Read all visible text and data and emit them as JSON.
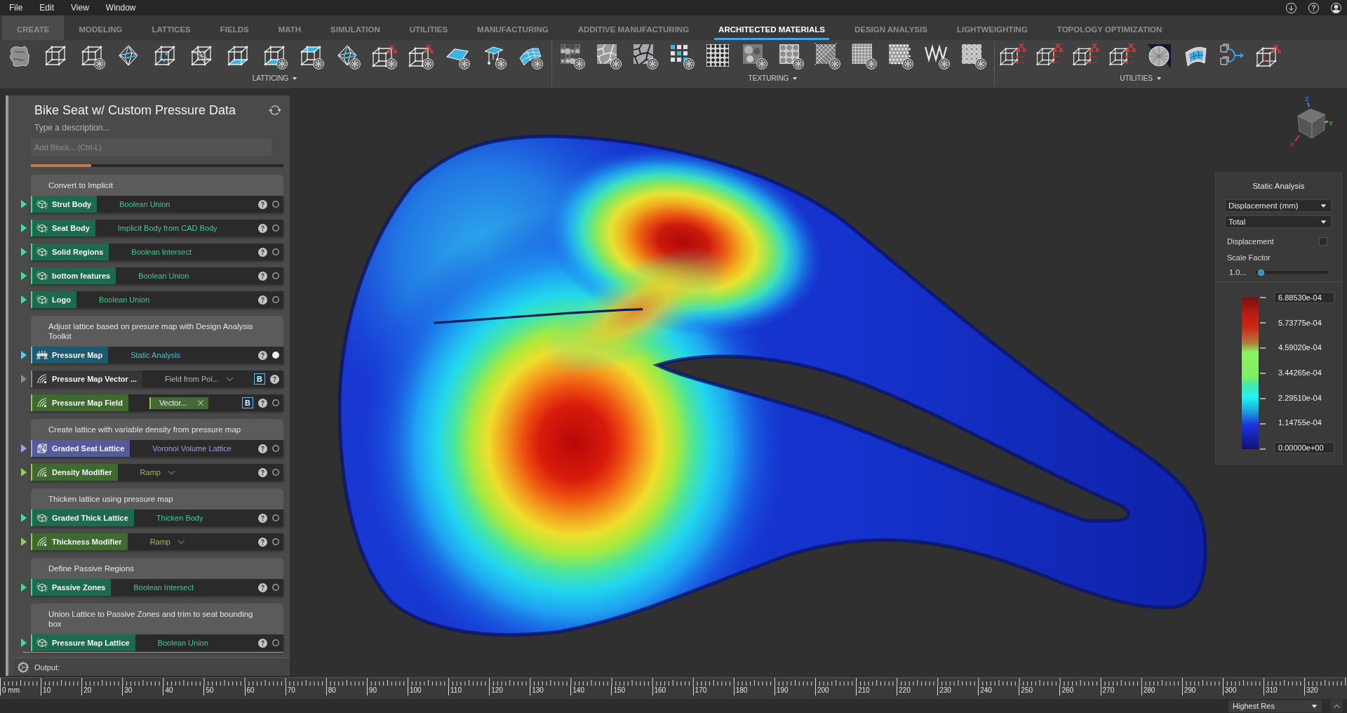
{
  "menu_bar": {
    "items": [
      "File",
      "Edit",
      "View",
      "Window"
    ]
  },
  "tabs": [
    {
      "label": "CREATE",
      "selected": false,
      "hovered": true
    },
    {
      "label": "MODELING",
      "selected": false,
      "hovered": false
    },
    {
      "label": "LATTICES",
      "selected": false,
      "hovered": false
    },
    {
      "label": "FIELDS",
      "selected": false,
      "hovered": false
    },
    {
      "label": "MATH",
      "selected": false,
      "hovered": false
    },
    {
      "label": "SIMULATION",
      "selected": false,
      "hovered": false
    },
    {
      "label": "UTILITIES",
      "selected": false,
      "hovered": false
    },
    {
      "label": "MANUFACTURING",
      "selected": false,
      "hovered": false
    },
    {
      "label": "ADDITIVE MANUFACTURING",
      "selected": false,
      "hovered": false
    },
    {
      "label": "ARCHITECTED MATERIALS",
      "selected": true,
      "hovered": false
    },
    {
      "label": "DESIGN ANALYSIS",
      "selected": false,
      "hovered": false
    },
    {
      "label": "LIGHTWEIGHTING",
      "selected": false,
      "hovered": false
    },
    {
      "label": "TOPOLOGY OPTIMIZATION",
      "selected": false,
      "hovered": false
    }
  ],
  "toolbar": {
    "groups": [
      {
        "label": "LATTICING"
      },
      {
        "label": "TEXTURING"
      },
      {
        "label": "UTILITIES"
      }
    ]
  },
  "workflow_panel": {
    "title": "Bike Seat w/ Custom Pressure Data",
    "description": {
      "placeholder": "Type a description..."
    },
    "add_block": {
      "placeholder": "Add Block... (Ctrl-L)"
    },
    "progress": {
      "level": 0.24
    },
    "sections": [
      {
        "heading": "Convert to Implicit",
        "blocks": [
          {
            "name": "Strut Body",
            "kind": "implicit",
            "operation": {
              "kind": "text",
              "label": "Boolean Union"
            },
            "expandable": true,
            "indicator": {
              "active": false
            }
          },
          {
            "name": "Seat Body",
            "kind": "implicit",
            "operation": {
              "kind": "text",
              "label": "Implicit Body from CAD Body"
            },
            "expandable": true,
            "indicator": {
              "active": false
            }
          },
          {
            "name": "Solid Regions",
            "kind": "implicit",
            "operation": {
              "kind": "text",
              "label": "Boolean Intersect"
            },
            "expandable": true,
            "indicator": {
              "active": false
            }
          },
          {
            "name": "bottom features",
            "kind": "implicit",
            "operation": {
              "kind": "text",
              "label": "Boolean Union"
            },
            "expandable": true,
            "indicator": {
              "active": false
            }
          },
          {
            "name": "Logo",
            "kind": "implicit",
            "operation": {
              "kind": "text",
              "label": "Boolean Union"
            },
            "expandable": true,
            "indicator": {
              "active": false
            }
          }
        ]
      },
      {
        "heading": "Adjust lattice based on presure map with Design Analysis Toolkit",
        "blocks": [
          {
            "name": "Pressure Map",
            "kind": "analysis",
            "operation": {
              "kind": "text",
              "label": "Static Analysis"
            },
            "expandable": true,
            "indicator": {
              "active": true
            }
          },
          {
            "name": "Pressure Map Vector ...",
            "kind": "data",
            "operation": {
              "kind": "dropdown",
              "label": "Field from Poi..."
            },
            "expandable": true,
            "badge": "B"
          },
          {
            "name": "Pressure Map Field",
            "kind": "field",
            "operation": {
              "kind": "chip",
              "label": "Vector..."
            },
            "expandable": false,
            "badge": "B",
            "indicator": {
              "active": false
            }
          }
        ]
      },
      {
        "heading": "Create lattice with variable density from pressure map",
        "blocks": [
          {
            "name": "Graded Seat Lattice",
            "kind": "lattice",
            "operation": {
              "kind": "text",
              "label": "Voronoi Volume Lattice"
            },
            "expandable": true,
            "indicator": {
              "active": false
            }
          },
          {
            "name": "Density Modifier",
            "kind": "field",
            "operation": {
              "kind": "dropdown",
              "label": "Ramp"
            },
            "expandable": true,
            "indicator": {
              "active": false
            }
          }
        ]
      },
      {
        "heading": "Thicken lattice using pressure map",
        "blocks": [
          {
            "name": "Graded Thick Lattice",
            "kind": "implicit",
            "operation": {
              "kind": "text",
              "label": "Thicken Body"
            },
            "expandable": true,
            "indicator": {
              "active": false
            }
          },
          {
            "name": "Thickness Modifier",
            "kind": "field",
            "operation": {
              "kind": "dropdown",
              "label": "Ramp"
            },
            "expandable": true,
            "indicator": {
              "active": false
            }
          }
        ]
      },
      {
        "heading": "Define Passive Regions",
        "blocks": [
          {
            "name": "Passive Zones",
            "kind": "implicit",
            "operation": {
              "kind": "text",
              "label": "Boolean Intersect"
            },
            "expandable": true,
            "indicator": {
              "active": false
            }
          }
        ]
      },
      {
        "heading": "Union Lattice to Passive Zones and trim to seat bounding box",
        "blocks": [
          {
            "name": "Pressure Map Lattice",
            "kind": "implicit",
            "operation": {
              "kind": "text",
              "label": "Boolean Union"
            },
            "expandable": true,
            "indicator": {
              "active": false
            }
          }
        ]
      }
    ],
    "output": {
      "label": "Output:"
    }
  },
  "viewport": {
    "view_cube": {
      "axes": [
        "Z",
        "Y",
        "X"
      ]
    }
  },
  "analysis_panel": {
    "title": "Static Analysis",
    "result_type": "Displacement (mm)",
    "component": "Total",
    "displacement_toggle": {
      "label": "Displacement",
      "checked": false
    },
    "scale_factor": {
      "label": "Scale Factor",
      "value": "1.0...",
      "level": 0.03
    },
    "legend": [
      {
        "value": "6.88530e-04",
        "kind": "field"
      },
      {
        "value": "5.73775e-04",
        "kind": "label"
      },
      {
        "value": "4.59020e-04",
        "kind": "label"
      },
      {
        "value": "3.44265e-04",
        "kind": "label"
      },
      {
        "value": "2.29510e-04",
        "kind": "label"
      },
      {
        "value": "1.14755e-04",
        "kind": "label"
      },
      {
        "value": "0.00000e+00",
        "kind": "field"
      }
    ]
  },
  "ruler": {
    "labels": [
      "0 mm",
      "10",
      "20",
      "30",
      "40",
      "50",
      "60",
      "70",
      "80",
      "90",
      "100",
      "110",
      "120",
      "130",
      "140",
      "150",
      "160",
      "170",
      "180",
      "190",
      "200",
      "210",
      "220",
      "230",
      "240",
      "250",
      "260",
      "270",
      "280",
      "290",
      "300",
      "310",
      "320"
    ]
  },
  "status_bar": {
    "render_quality": "Highest Res"
  }
}
